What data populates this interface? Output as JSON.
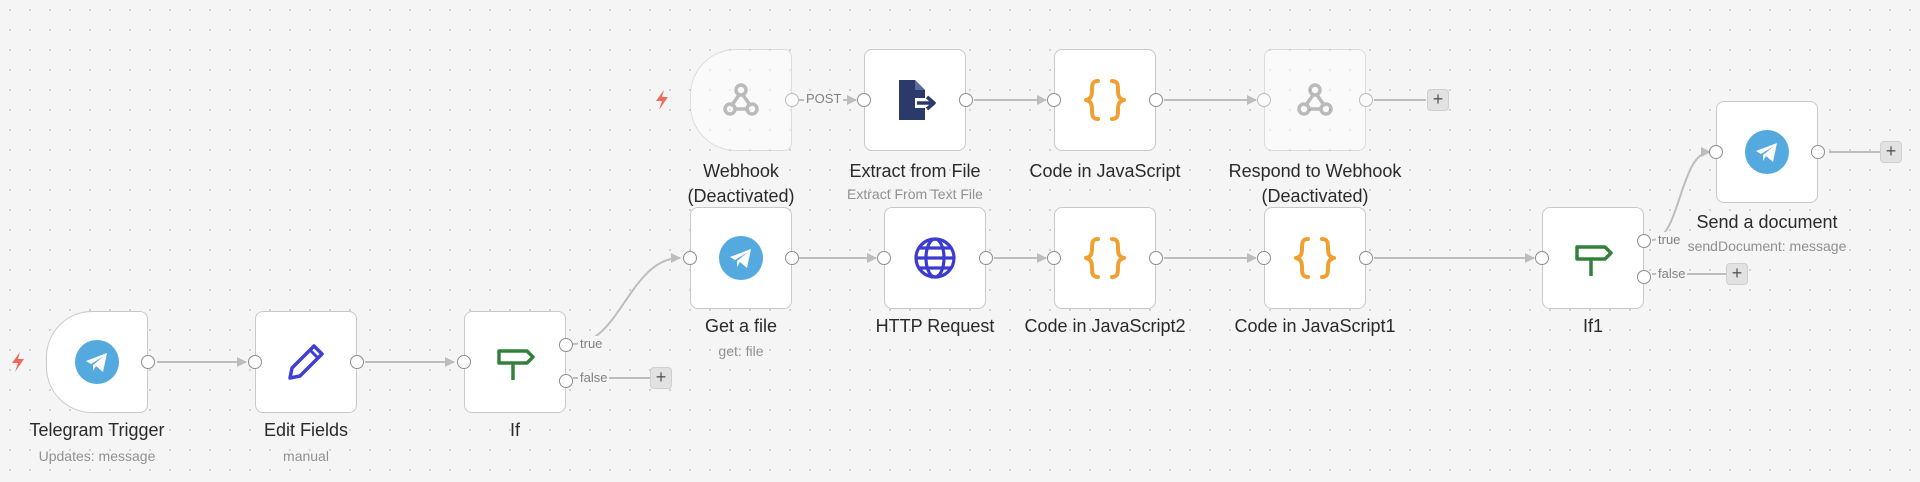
{
  "colors": {
    "canvas": "#f5f5f5",
    "edge": "#bdbdbd",
    "telegram_blue": "#54a9df",
    "pencil_blue": "#3d3fd6",
    "if_green": "#35803c",
    "code_orange": "#f0a030",
    "webhook_gray": "#8a8a8a",
    "extract_navy": "#2b3a6b",
    "http_blue": "#3b3bcf",
    "trigger_bolt": "#ec6a5e"
  },
  "nodes": {
    "telegram_trigger": {
      "name": "Telegram Trigger",
      "subtitle": "Updates: message",
      "icon": "telegram-icon"
    },
    "edit_fields": {
      "name": "Edit Fields",
      "subtitle": "manual",
      "icon": "pencil-icon"
    },
    "if": {
      "name": "If",
      "true_label": "true",
      "false_label": "false",
      "icon": "signpost-icon"
    },
    "webhook": {
      "name": "Webhook (Deactivated)",
      "icon": "webhook-icon"
    },
    "extract_from_file": {
      "name": "Extract from File",
      "subtitle": "Extract From Text File",
      "icon": "file-export-icon"
    },
    "code_in_javascript": {
      "name": "Code in JavaScript",
      "icon": "code-braces-icon"
    },
    "respond_to_webhook": {
      "name": "Respond to Webhook (Deactivated)",
      "icon": "webhook-icon"
    },
    "get_a_file": {
      "name": "Get a file",
      "subtitle": "get: file",
      "icon": "telegram-icon"
    },
    "http_request": {
      "name": "HTTP Request",
      "icon": "globe-icon"
    },
    "code_in_javascript2": {
      "name": "Code in JavaScript2",
      "icon": "code-braces-icon"
    },
    "code_in_javascript1": {
      "name": "Code in JavaScript1",
      "icon": "code-braces-icon"
    },
    "if1": {
      "name": "If1",
      "true_label": "true",
      "false_label": "false",
      "icon": "signpost-icon"
    },
    "send_a_document": {
      "name": "Send a document",
      "subtitle": "sendDocument: message",
      "icon": "telegram-icon"
    }
  },
  "edge_labels": {
    "webhook_method": "POST"
  },
  "add_button_symbol": "+"
}
